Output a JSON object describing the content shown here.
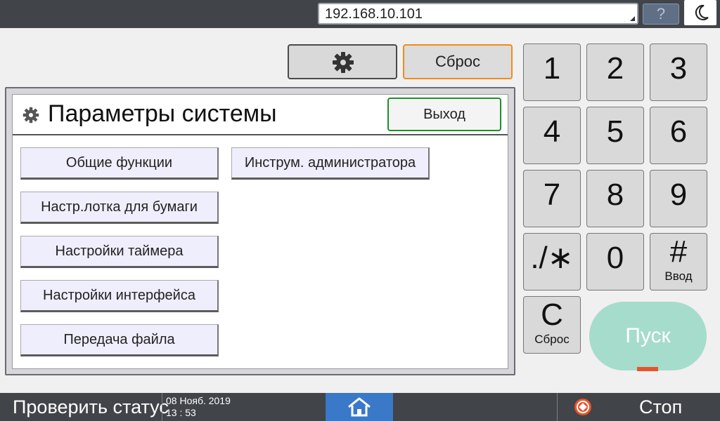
{
  "topbar": {
    "address": "192.168.10.101",
    "help_label": "?"
  },
  "controls": {
    "reset_label": "Сброс"
  },
  "panel": {
    "title": "Параметры системы",
    "exit_label": "Выход",
    "buttons": [
      "Общие функции",
      "Настр.лотка для бумаги",
      "Настройки таймера",
      "Настройки интерфейса",
      "Передача файла",
      "Инструм. администратора"
    ]
  },
  "keypad": {
    "keys": [
      "1",
      "2",
      "3",
      "4",
      "5",
      "6",
      "7",
      "8",
      "9",
      "./∗",
      "0",
      "#"
    ],
    "enter_sub": "Ввод",
    "clear_main": "C",
    "clear_sub": "Сброс",
    "start_label": "Пуск"
  },
  "bottombar": {
    "status_label": "Проверить статус",
    "date": "08 Нояб. 2019",
    "time": "13 : 53",
    "stop_label": "Стоп"
  },
  "colors": {
    "bar_bg": "#414449",
    "home_accent": "#3a78c8",
    "reset_border": "#f08c1e",
    "exit_border": "#1f8f2a",
    "start_bg": "#a6dccc",
    "stop_icon": "#e8542a"
  },
  "icons": {
    "settings": "gear-icon",
    "theme": "moon-icon",
    "home": "home-icon",
    "stop": "stop-icon"
  }
}
